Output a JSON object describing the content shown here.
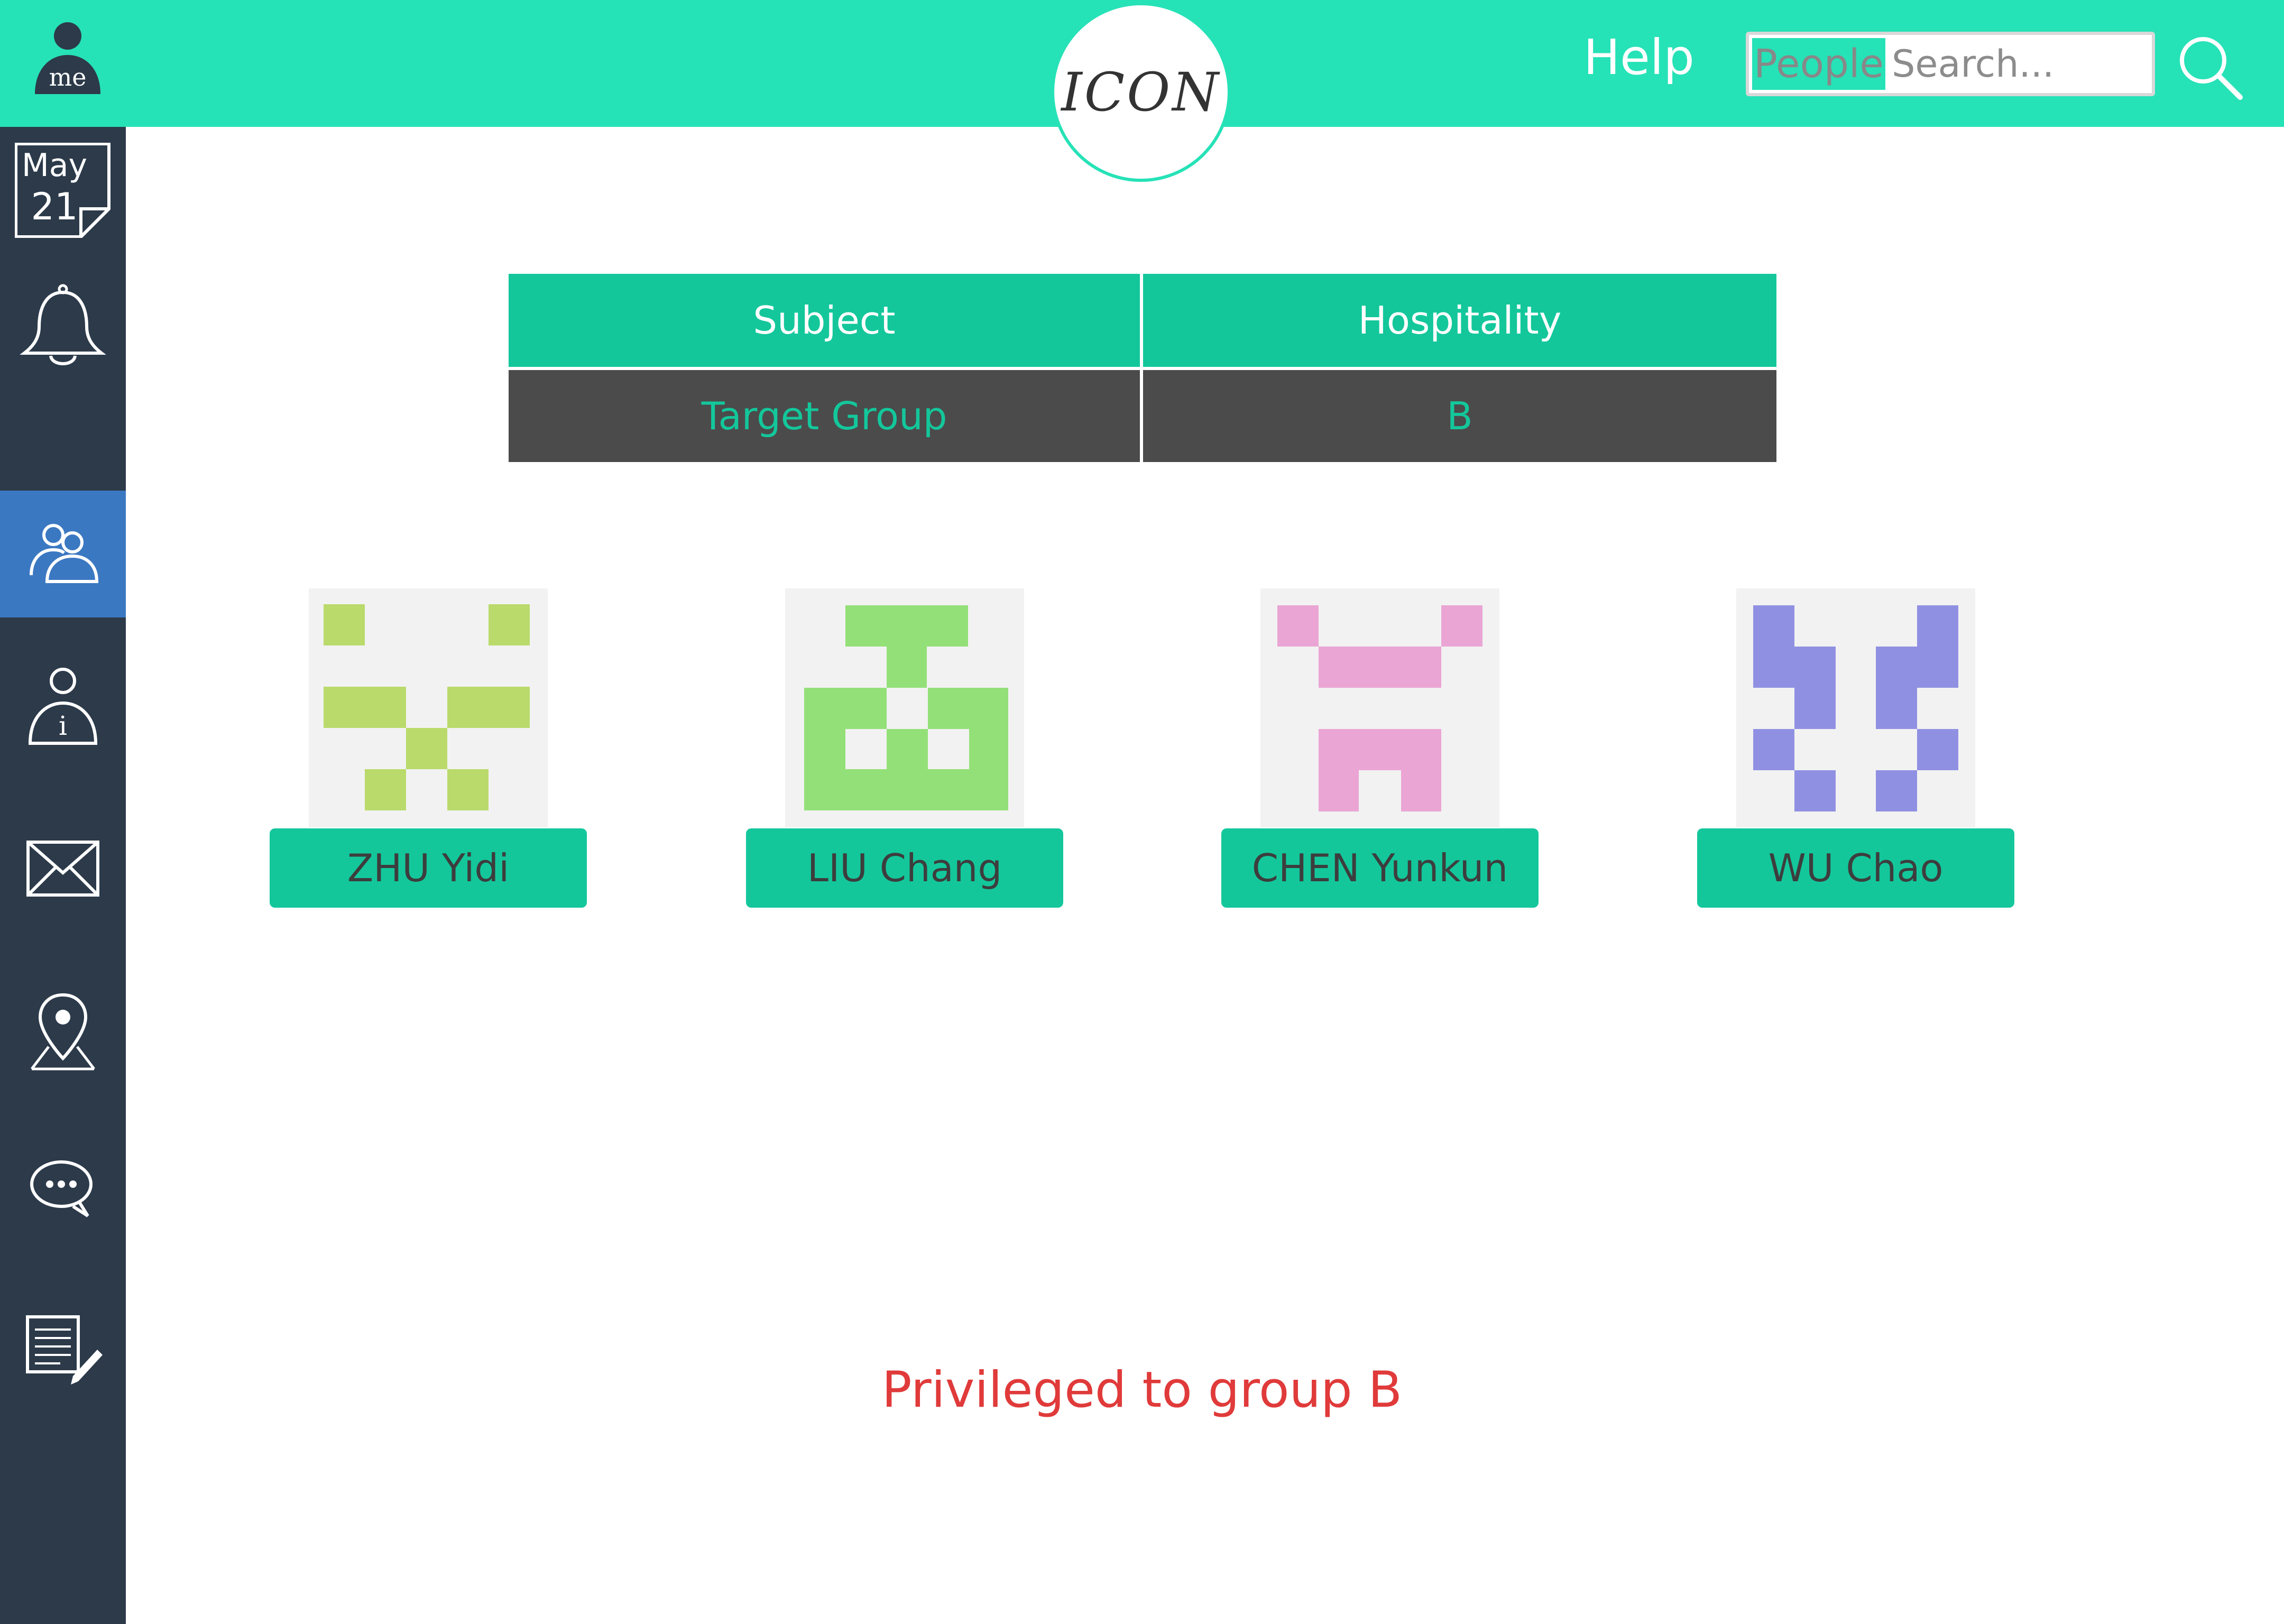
{
  "header": {
    "me_label": "me",
    "logo": "ICON",
    "help": "Help",
    "search": {
      "scope": "People",
      "placeholder": "Search..."
    },
    "search_icon": "search-icon"
  },
  "sidebar": {
    "date": {
      "month": "May",
      "day": "21"
    },
    "items": [
      {
        "icon": "calendar-icon"
      },
      {
        "icon": "bell-icon"
      },
      {
        "icon": "people-icon",
        "active": true
      },
      {
        "icon": "person-info-icon"
      },
      {
        "icon": "mail-icon"
      },
      {
        "icon": "map-pin-icon"
      },
      {
        "icon": "chat-icon"
      },
      {
        "icon": "note-edit-icon"
      }
    ]
  },
  "info_table": {
    "headers": [
      "Subject",
      "Hospitality"
    ],
    "row": [
      "Target Group",
      "B"
    ]
  },
  "people": [
    {
      "name": "ZHU Yidi",
      "color": "#bada6b"
    },
    {
      "name": "LIU Chang",
      "color": "#93e078"
    },
    {
      "name": "CHEN Yunkun",
      "color": "#eaa5d4"
    },
    {
      "name": "WU Chao",
      "color": "#9090e3"
    }
  ],
  "status_message": "Privileged to group B",
  "colors": {
    "topbar": "#26e2b7",
    "sidebar": "#2c3a4a",
    "active_item": "#3b78c2",
    "accent": "#13c79b",
    "message": "#e03a3a"
  }
}
